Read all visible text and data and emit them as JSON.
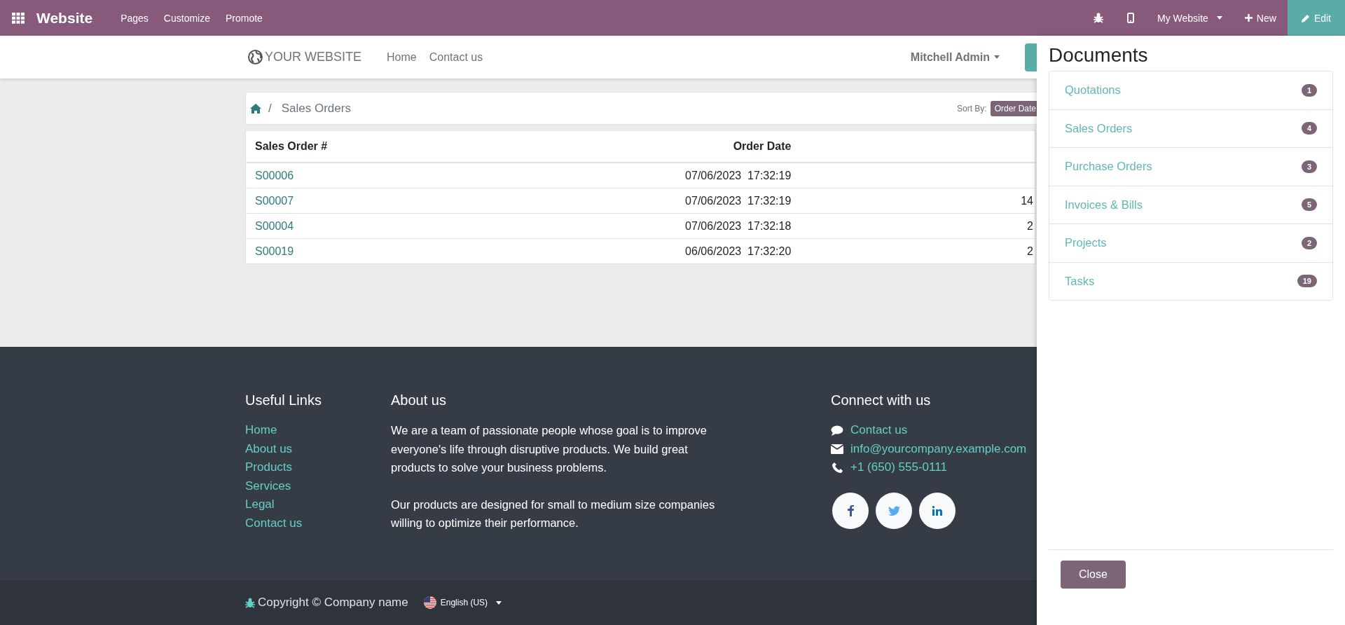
{
  "top_bar": {
    "app_name": "Website",
    "menu": [
      "Pages",
      "Customize",
      "Promote"
    ],
    "website_menu": "My Website",
    "new_button": "New",
    "edit_button": "Edit"
  },
  "header": {
    "logo": "YOUR WEBSITE",
    "nav": [
      "Home",
      "Contact us"
    ],
    "user": "Mitchell Admin"
  },
  "breadcrumb": {
    "separator": "/",
    "current": "Sales Orders",
    "sort_label": "Sort By:",
    "sort_value": "Order Date"
  },
  "table": {
    "columns": [
      "Sales Order #",
      "Order Date"
    ],
    "rows": [
      {
        "order": "S00006",
        "date": "07/06/2023  17:32:19"
      },
      {
        "order": "S00007",
        "date": "07/06/2023  17:32:19",
        "column_3": "14"
      },
      {
        "order": "S00004",
        "date": "07/06/2023  17:32:18",
        "column_3": "2"
      },
      {
        "order": "S00019",
        "date": "06/06/2023  17:32:20",
        "column_3": "2"
      }
    ]
  },
  "footer": {
    "useful_links": {
      "title": "Useful Links",
      "links": [
        "Home",
        "About us",
        "Products",
        "Services",
        "Legal",
        "Contact us"
      ]
    },
    "about": {
      "title": "About us",
      "paragraphs": [
        "We are a team of passionate people whose goal is to improve everyone's life through disruptive products. We build great products to solve your business problems.",
        "Our products are designed for small to medium size companies willing to optimize their performance."
      ]
    },
    "connect": {
      "title": "Connect with us",
      "items": [
        {
          "kind": "comment",
          "text": "Contact us"
        },
        {
          "kind": "email",
          "text": "info@yourcompany.example.com"
        },
        {
          "kind": "phone",
          "text": "+1 (650) 555-0111"
        }
      ],
      "social": [
        {
          "kind": "facebook"
        },
        {
          "kind": "twitter"
        },
        {
          "kind": "linkedin"
        }
      ]
    }
  },
  "bottom_bar": {
    "copyright": "Copyright © Company name",
    "language": "English (US)"
  },
  "documents_panel": {
    "title": "Documents",
    "items": [
      {
        "label": "Quotations",
        "count": "1"
      },
      {
        "label": "Sales Orders",
        "count": "4"
      },
      {
        "label": "Purchase Orders",
        "count": "3"
      },
      {
        "label": "Invoices & Bills",
        "count": "5"
      },
      {
        "label": "Projects",
        "count": "2"
      },
      {
        "label": "Tasks",
        "count": "19"
      }
    ],
    "close_button": "Close"
  }
}
